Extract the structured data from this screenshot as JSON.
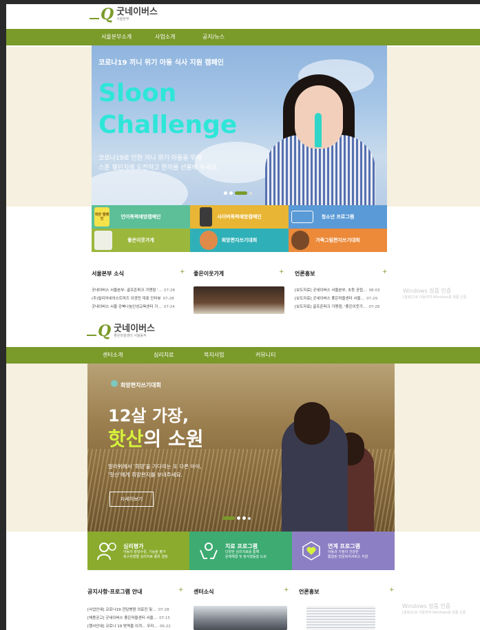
{
  "site1": {
    "logo_name": "굿네이버스",
    "logo_sub": "서울본부",
    "nav": [
      "서울본부소개",
      "사업소개",
      "공지/뉴스"
    ],
    "hero": {
      "caption": "코로나19 끼니 위기 아동 식사 지원 캠페인",
      "title_line1": "Sloon",
      "title_line2": "Challenge",
      "desc_line1": "코로나19로 인한 끼니 위기 아동을 위해",
      "desc_line2": "스푼 챌린지에 도전하고 한끼를 선물해 주세요."
    },
    "tiles": [
      {
        "label": "언어폭력예방캠페인",
        "color": "#5cbf98"
      },
      {
        "label": "사이버폭력예방캠페인",
        "color": "#e8b634"
      },
      {
        "label": "청소년 프로그램",
        "color": "#5a9ad6"
      },
      {
        "label": "좋은이웃가게",
        "color": "#9bb73c"
      },
      {
        "label": "희망편지쓰기대회",
        "color": "#2fb0b8"
      },
      {
        "label": "가족그림편지쓰기대회",
        "color": "#ec8a3a"
      }
    ],
    "tile_badge": "착한 캠페인",
    "sections": {
      "news_title": "서울본부 소식",
      "shop_title": "좋은이웃가게",
      "press_title": "언론홍보",
      "plus": "+"
    },
    "news": [
      {
        "text": "굿네이버스 서울본부- 골프존파크 가맹점 '…",
        "date": "07-28"
      },
      {
        "text": "(주)빌리어네어스트머즈 이광민 대표 인터뷰",
        "date": "07-28"
      },
      {
        "text": "굿네이버스 서울 강북나눔인성교육센터 가…",
        "date": "07-24"
      }
    ],
    "press": [
      {
        "text": "[보도자료] 굿네이버스 서울본부, 초등 공립…",
        "date": "08-03"
      },
      {
        "text": "[보도자료] 굿네이버스 좋은마을센터 서울…",
        "date": "07-29"
      },
      {
        "text": "[보도자료] 골프존파크 가맹점, '좋은이웃가…",
        "date": "07-28"
      }
    ],
    "watermark_title": "Windows 정품 인증",
    "watermark_sub": "[설정]으로 이동하여 Windows를 정품 인증"
  },
  "site2": {
    "logo_name": "굿네이버스",
    "logo_sub": "좋은마을센터 서울동작",
    "nav": [
      "센터소개",
      "심리치료",
      "복지사업",
      "커뮤니티"
    ],
    "hero": {
      "caption": "희망편지쓰기대회",
      "line1": "12살 가장,",
      "line2_accent": "핫산",
      "line2_rest": "의 소원",
      "desc_line1": "말라위에서 '희망'을 기다리는 또 다른 아이,",
      "desc_line2": "'핫산'에게 희망편지를 보내주세요.",
      "button": "자세히보기"
    },
    "services": [
      {
        "title": "심리평가",
        "desc1": "아동의 발달수준, 기능을 평가",
        "desc2": "욕구유형별 심리지료 종류 결정",
        "color": "#8aab2e"
      },
      {
        "title": "치료 프로그램",
        "desc1": "다양한 심리치료를 통해",
        "desc2": "문제해결 및 정서행동을 도모",
        "color": "#3dab72"
      },
      {
        "title": "연계 프로그램",
        "desc1": "아동과 가정이 건강한",
        "desc2": "통합된 전문복지서비스 지원",
        "color": "#8d7fc4"
      }
    ],
    "sections": {
      "notice_title": "공지사항·프로그램 안내",
      "center_title": "센터소식",
      "press_title": "언론홍보",
      "plus": "+"
    },
    "notices": [
      {
        "text": "[사업안내] 코로나19 전담병원 의료진 및…",
        "date": "07-28"
      },
      {
        "text": "[채용공고] 굿네이버스 좋은마을센터 서울…",
        "date": "07-15"
      },
      {
        "text": "[행사안내] 코로나 19 방역을 이겨… 우리…",
        "date": "06-22"
      }
    ],
    "watermark_title": "Windows 정품 인증",
    "watermark_sub": "[설정]으로 이동하여 Windows를 정품 인증"
  }
}
